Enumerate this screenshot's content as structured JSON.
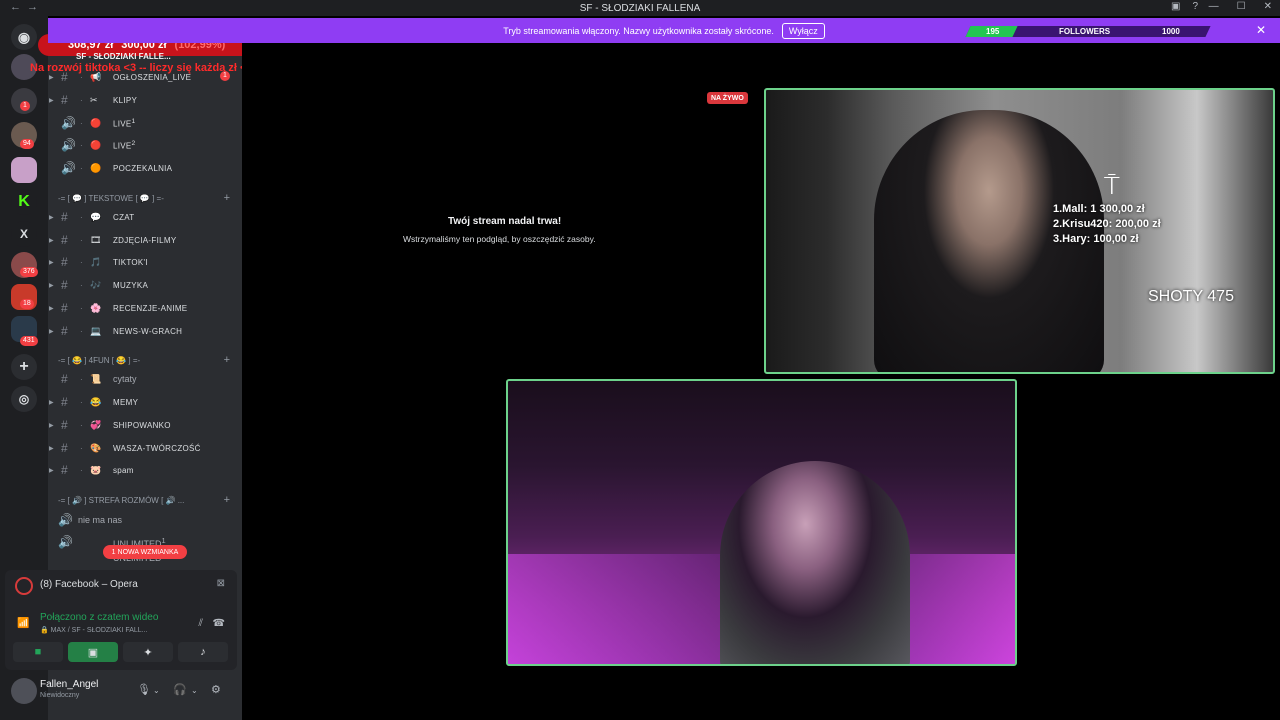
{
  "titlebar": {
    "title": "SF - SŁODZIAKI FALLENA",
    "nav_back": "←",
    "nav_forward": "→",
    "icons": [
      "inbox-icon",
      "help-icon"
    ],
    "window_buttons": [
      "minimize-icon",
      "maximize-icon",
      "close-icon"
    ]
  },
  "banner": {
    "text": "Tryb streamowania włączony. Nazwy użytkownika zostały skrócone.",
    "button_label": "Wyłącz",
    "close_icon": "✕"
  },
  "followers_widget": {
    "current": "195",
    "label": "FOLLOWERS",
    "goal": "1000",
    "progress_fraction": 0.195
  },
  "donation_overlay": {
    "current": "308,97 zł",
    "target": "300,00 zł",
    "percent": "(102,99%)",
    "message": "Na rozwój tiktoka <3 -- liczy się każda zł <3"
  },
  "guilds": [
    {
      "name": "discord-home-icon",
      "badge": ""
    },
    {
      "name": "server-1",
      "badge": ""
    },
    {
      "name": "server-2",
      "badge": "1"
    },
    {
      "name": "server-3",
      "badge": "94"
    },
    {
      "name": "server-planets",
      "badge": ""
    },
    {
      "name": "server-kick",
      "label": "K",
      "badge": ""
    },
    {
      "name": "server-x",
      "label": "X",
      "badge": ""
    },
    {
      "name": "server-4",
      "badge": "376"
    },
    {
      "name": "server-5",
      "badge": "18"
    },
    {
      "name": "server-folder",
      "badge": "431"
    }
  ],
  "server_header": {
    "name": "SF - SŁODZIAKI FALLE..."
  },
  "channels": [
    {
      "name": "OGŁOSZENIA_LIVE",
      "emoji": "📢",
      "badge": "1"
    },
    {
      "name": "KLIPY",
      "emoji": "✂",
      "badge": ""
    },
    {
      "name": "LIVE",
      "sup": "1",
      "emoji": "🔴",
      "voice": true
    },
    {
      "name": "LIVE",
      "sup": "2",
      "emoji": "🔴",
      "voice": true
    },
    {
      "name": "POCZEKALNIA",
      "emoji": "🟠",
      "voice": true
    }
  ],
  "categories": {
    "text": "-= [ 💬 ] TEKSTOWE [ 💬 ] =-",
    "fun": "-= [ 😂 ] 4FUN [ 😂 ] =-",
    "voice": "-= [ 🔊 ] STREFA ROZMÓW [ 🔊 ..."
  },
  "text_channels": [
    {
      "name": "CZAT",
      "emoji": "💬"
    },
    {
      "name": "ZDJĘCIA-FILMY",
      "emoji": "🎞"
    },
    {
      "name": "TIKTOK'I",
      "emoji": "🎵"
    },
    {
      "name": "MUZYKA",
      "emoji": "🎶"
    },
    {
      "name": "RECENZJE-ANIME",
      "emoji": "🌸"
    },
    {
      "name": "NEWS-W-GRACH",
      "emoji": "💻"
    }
  ],
  "fun_channels": [
    {
      "name": "cytaty",
      "emoji": "📜",
      "muted": true
    },
    {
      "name": "MEMY",
      "emoji": "😂"
    },
    {
      "name": "SHIPOWANKO",
      "emoji": "💞"
    },
    {
      "name": "WASZA-TWÓRCZOŚĆ",
      "emoji": "🎨"
    },
    {
      "name": "spam",
      "emoji": "🐷"
    }
  ],
  "voice_channels": [
    {
      "name": "nie ma nas"
    },
    {
      "name": "UNLIMITED",
      "sup": "1"
    },
    {
      "name": "UNLIMITED",
      "sup": "2"
    }
  ],
  "mention_pill": "1 NOWA WZMIANKA",
  "activity_panel": {
    "app": "(8) Facebook – Opera",
    "status": "Połączono z czatem wideo",
    "substatus": "🔒 MAX / SF - SŁODZIAKI FALL..."
  },
  "user": {
    "name": "Fallen_Angel",
    "status": "Niewidoczny"
  },
  "stream_pause": {
    "title": "Twój stream nadal trwa!",
    "subtitle": "Wstrzymaliśmy ten podgląd, by oszczędzić zasoby."
  },
  "live_badge": "NA ŻYWO",
  "overlay_ranking": [
    "1.Mall: 1 300,00 zł",
    "2.Krisu420: 200,00 zł",
    "3.Hary: 100,00 zł"
  ],
  "overlay_shots": "SHOTY 475",
  "colors": {
    "accent": "#8f3df3",
    "live_red": "#da373c",
    "speaking_green": "#6dd28b",
    "followers_green": "#23c552"
  }
}
